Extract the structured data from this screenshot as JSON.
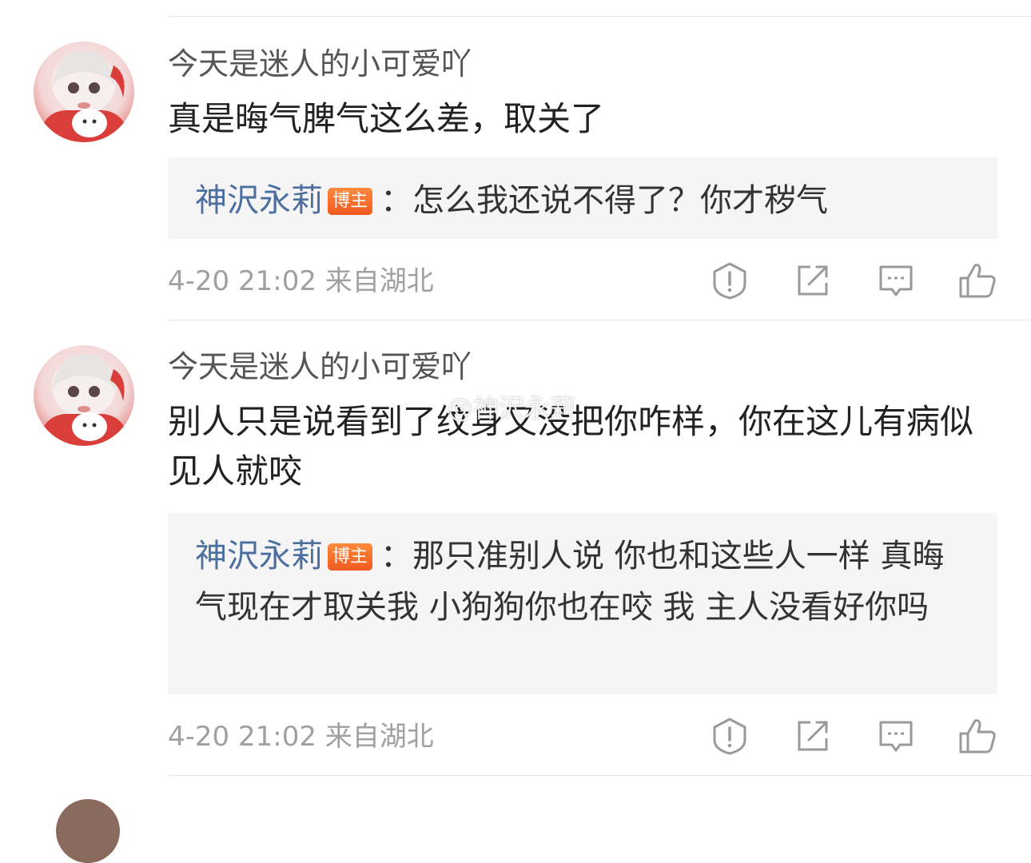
{
  "comments": [
    {
      "username": "今天是迷人的小可爱吖",
      "content": "真是晦气脾气这么差，取关了",
      "reply": {
        "name": "神沢永莉",
        "badge": "博主",
        "separator": "：",
        "text": "怎么我还说不得了？你才秽气"
      },
      "time": "4-20 21:02",
      "location": "来自湖北"
    },
    {
      "username": "今天是迷人的小可爱吖",
      "content": "别人只是说看到了纹身又没把你咋样，你在这儿有病似见人就咬",
      "reply": {
        "name": "神沢永莉",
        "badge": "博主",
        "separator": "：",
        "text": "那只准别人说 你也和这些人一样 真晦气现在才取关我 小狗狗你也在咬 我 主人没看好你吗"
      },
      "time": "4-20 21:02",
      "location": "来自湖北"
    }
  ],
  "watermark": "@神沢永莉",
  "icons": [
    "report-icon",
    "repost-icon",
    "comment-icon",
    "like-icon"
  ],
  "colors": {
    "reply_name": "#4c6f9f",
    "badge": "#f05a1f",
    "meta": "#a0a0a0"
  }
}
